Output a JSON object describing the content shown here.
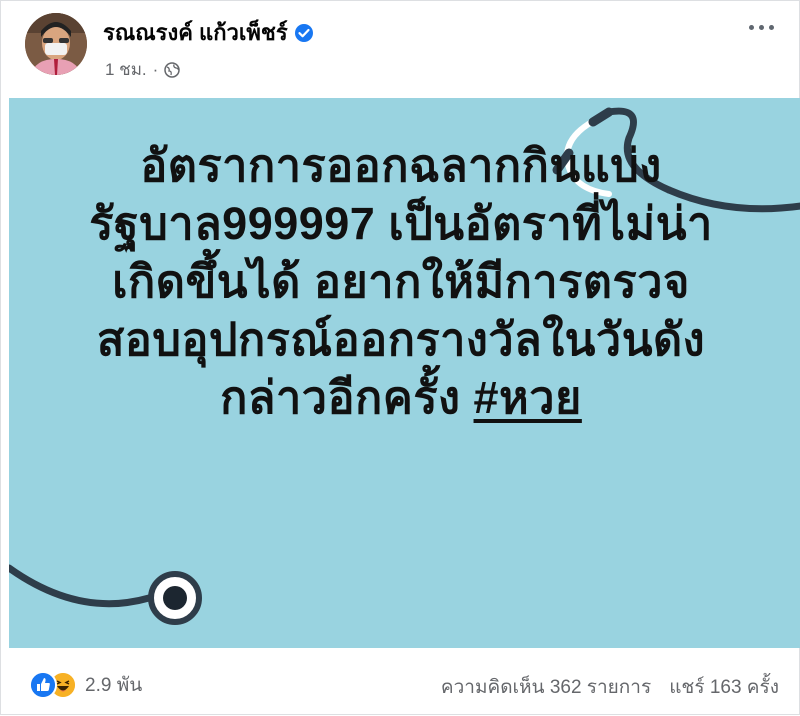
{
  "post": {
    "author": "รณณรงค์ แก้วเพ็ชร์",
    "time": "1 ชม.",
    "separator": "·",
    "text_lines": [
      "อัตราการออกฉลากกินแบ่ง",
      "รัฐบาล999997 เป็นอัตราที่ไม่น่า",
      "เกิดขึ้นได้ อยากให้มีการตรวจ",
      "สอบอุปกรณ์ออกรางวัลในวันดัง",
      "กล่าวอีกครั้ง"
    ],
    "hashtag": "#หวย",
    "background_color": "#99d3e0"
  },
  "footer": {
    "reaction_count": "2.9 พัน",
    "comments": "ความคิดเห็น 362 รายการ",
    "shares": "แชร์ 163 ครั้ง"
  },
  "icons": {
    "verified": "verified-badge-icon",
    "privacy": "globe-icon",
    "more": "more-options-icon",
    "like": "like-reaction-icon",
    "haha": "haha-reaction-icon"
  },
  "colors": {
    "brand_blue": "#1877f2",
    "secondary_text": "#65676b",
    "haha_yellow": "#f7b125"
  }
}
